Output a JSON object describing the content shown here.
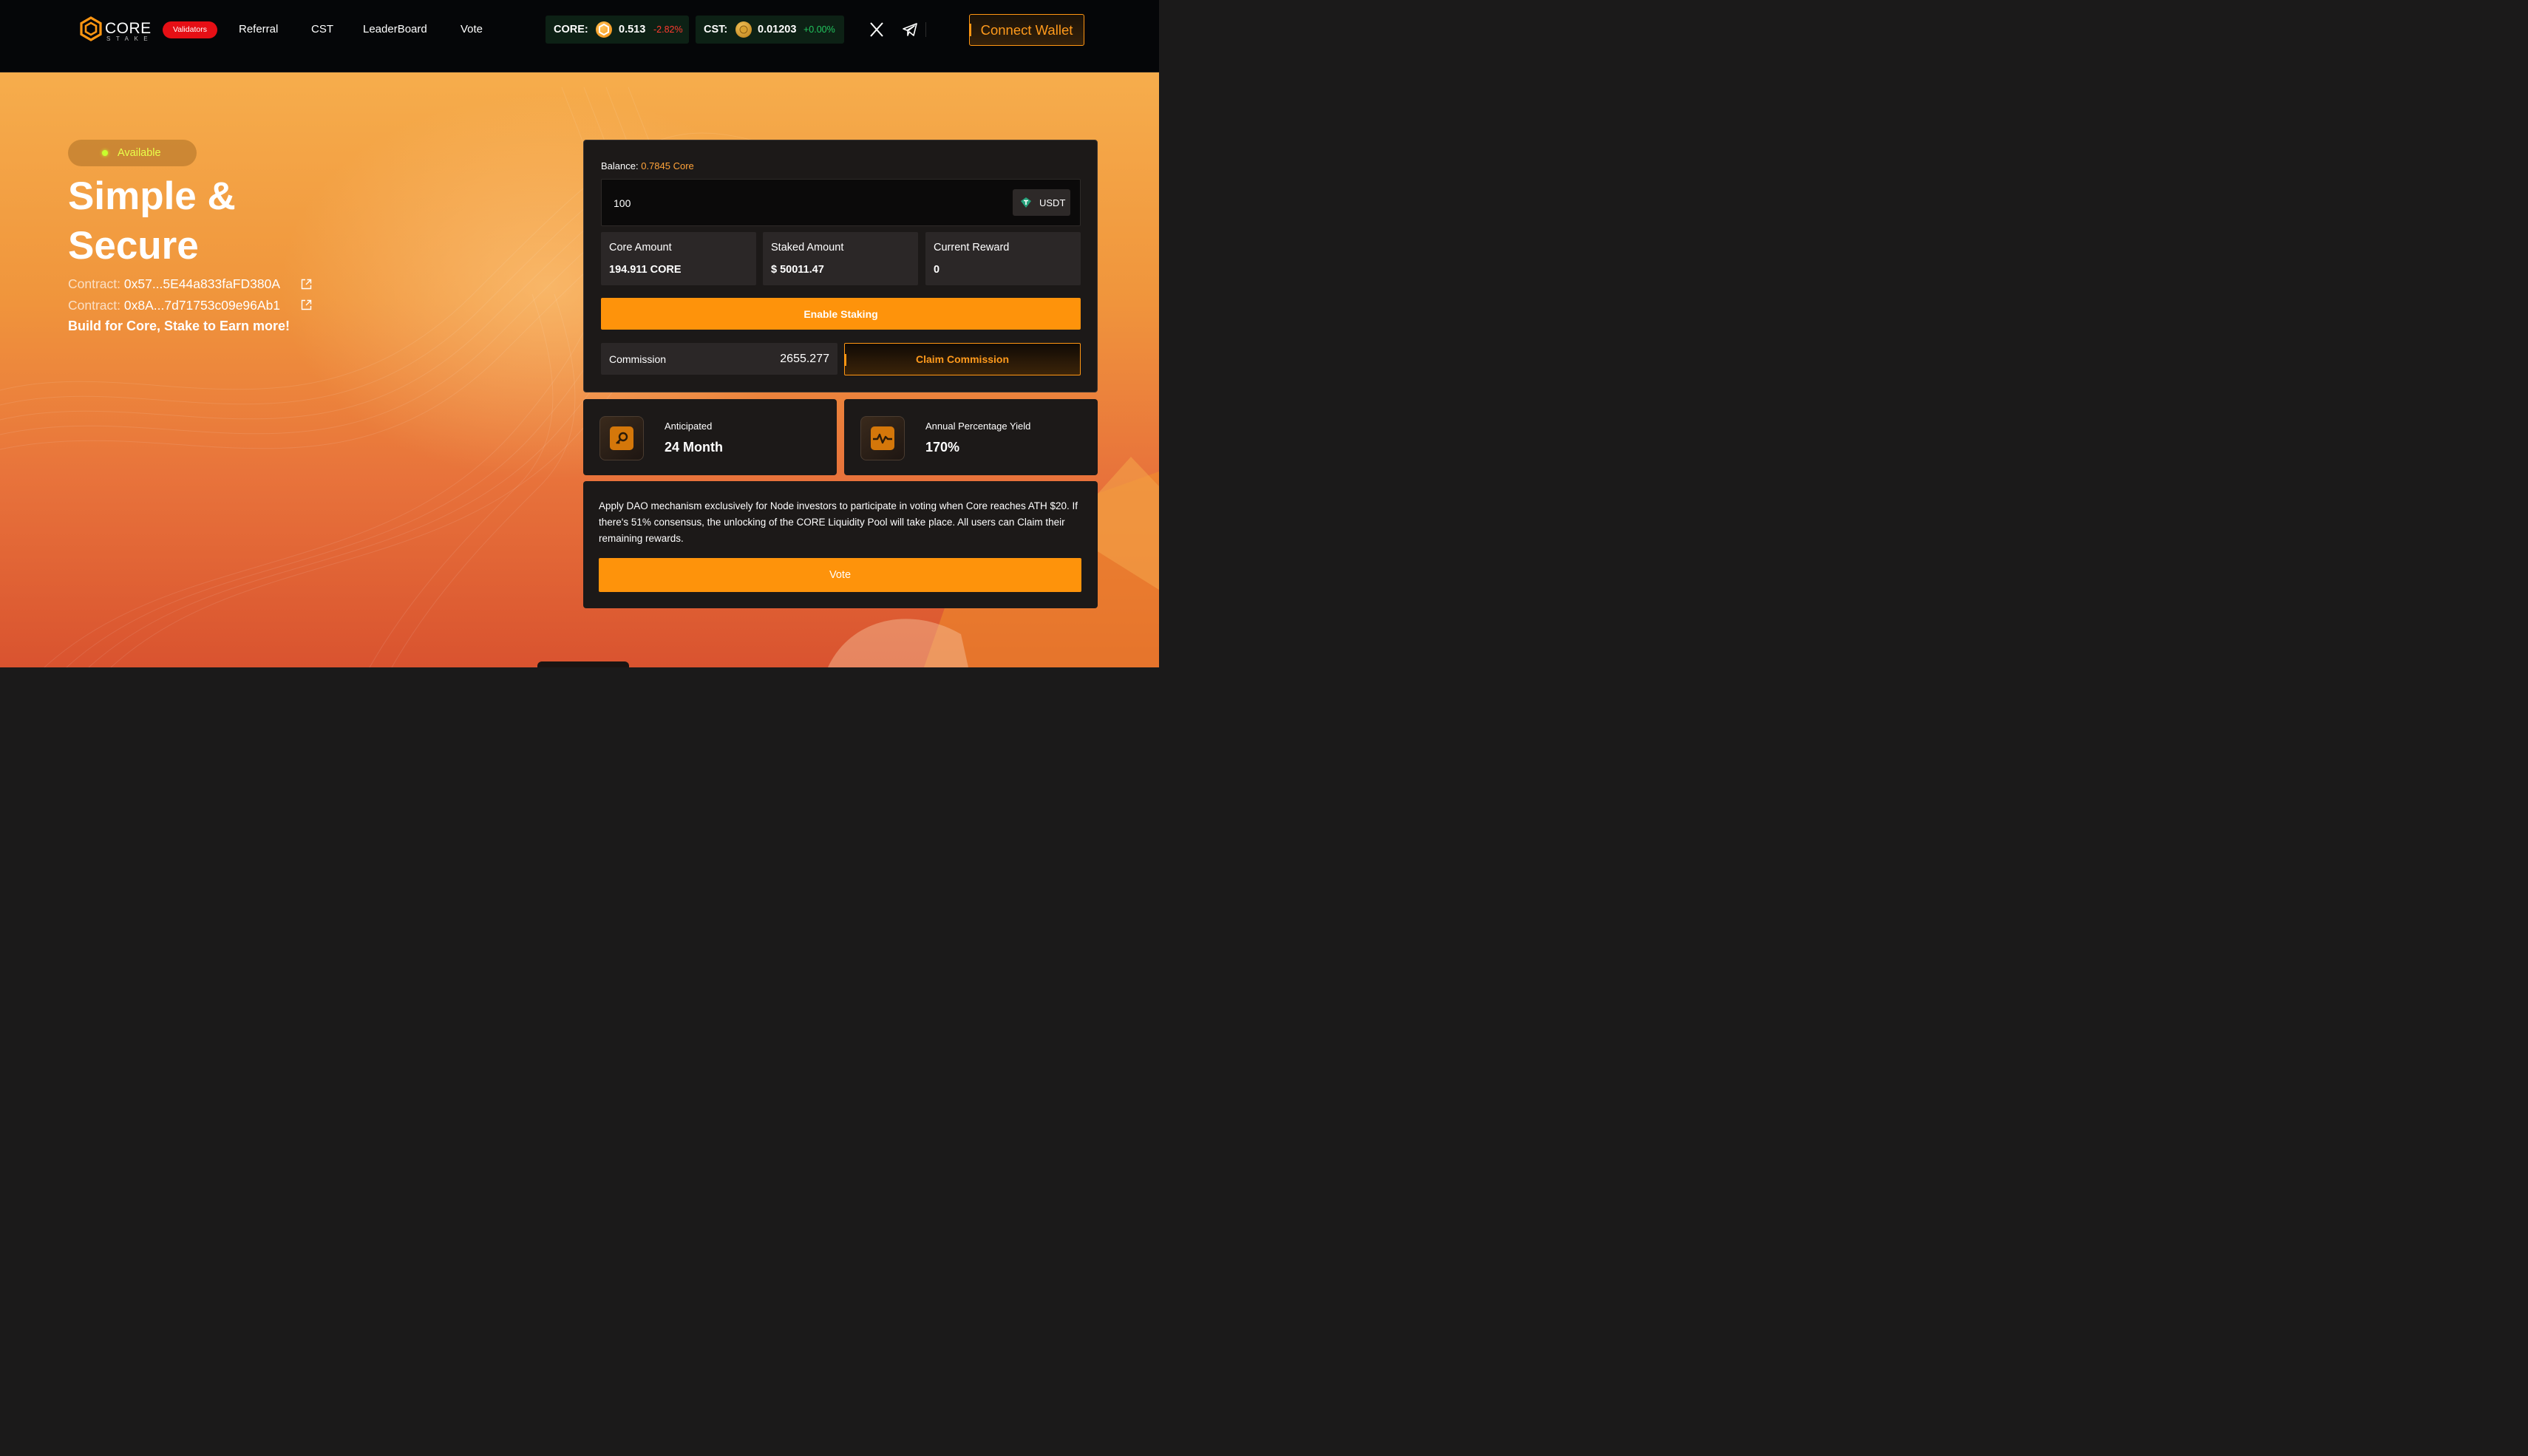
{
  "header": {
    "logo": {
      "word": "CORE",
      "sub": "STAKE",
      "icon": "core-hexagon-logo"
    },
    "validators_label": "Validators",
    "nav": [
      {
        "label": "Referral"
      },
      {
        "label": "CST"
      },
      {
        "label": "LeaderBoard"
      },
      {
        "label": "Vote"
      }
    ],
    "tickers": [
      {
        "label": "CORE:",
        "price": "0.513",
        "change": "-2.82%",
        "change_color": "#ff3b30",
        "icon": "core-coin-icon"
      },
      {
        "label": "CST:",
        "price": "0.01203",
        "change": "+0.00%",
        "change_color": "#22c55e",
        "icon": "cst-coin-icon"
      }
    ],
    "social": [
      "x-icon",
      "telegram-icon"
    ],
    "connect_label": "Connect Wallet"
  },
  "hero": {
    "status": "Available",
    "headline_line1": "Simple &",
    "headline_line2": "Secure",
    "contracts": [
      {
        "key": "Contract:",
        "value": "0x57...5E44a833faFD380A",
        "icon": "external-link-icon"
      },
      {
        "key": "Contract:",
        "value": "0x8A...7d71753c09e96Ab1",
        "icon": "external-link-icon"
      }
    ],
    "tagline": "Build for Core, Stake to Earn more!"
  },
  "staking": {
    "balance_label": "Balance:",
    "balance_value": "0.7845 Core",
    "amount_value": "100",
    "token_label": "USDT",
    "stats": [
      {
        "label": "Core Amount",
        "value": "194.911 CORE"
      },
      {
        "label": "Staked Amount",
        "value": "$ 50011.47"
      },
      {
        "label": "Current Reward",
        "value": "0"
      }
    ],
    "enable_label": "Enable Staking",
    "commission_label": "Commission",
    "commission_value": "2655.277",
    "claim_label": "Claim Commission"
  },
  "info_cards": [
    {
      "label": "Anticipated",
      "value": "24 Month",
      "icon": "key-icon"
    },
    {
      "label": "Annual Percentage Yield",
      "value": "170%",
      "icon": "pulse-chart-icon"
    }
  ],
  "dao": {
    "text": "Apply DAO mechanism exclusively for Node investors to participate in voting when Core reaches ATH $20. If there's 51% consensus, the unlocking of the CORE Liquidity Pool will take place. All users can Claim their remaining rewards.",
    "vote_label": "Vote"
  },
  "colors": {
    "accent": "#fe930b",
    "validators_bg": "#e60f15",
    "available_text": "#e9ff4a",
    "panel_bg": "#1c1918"
  }
}
